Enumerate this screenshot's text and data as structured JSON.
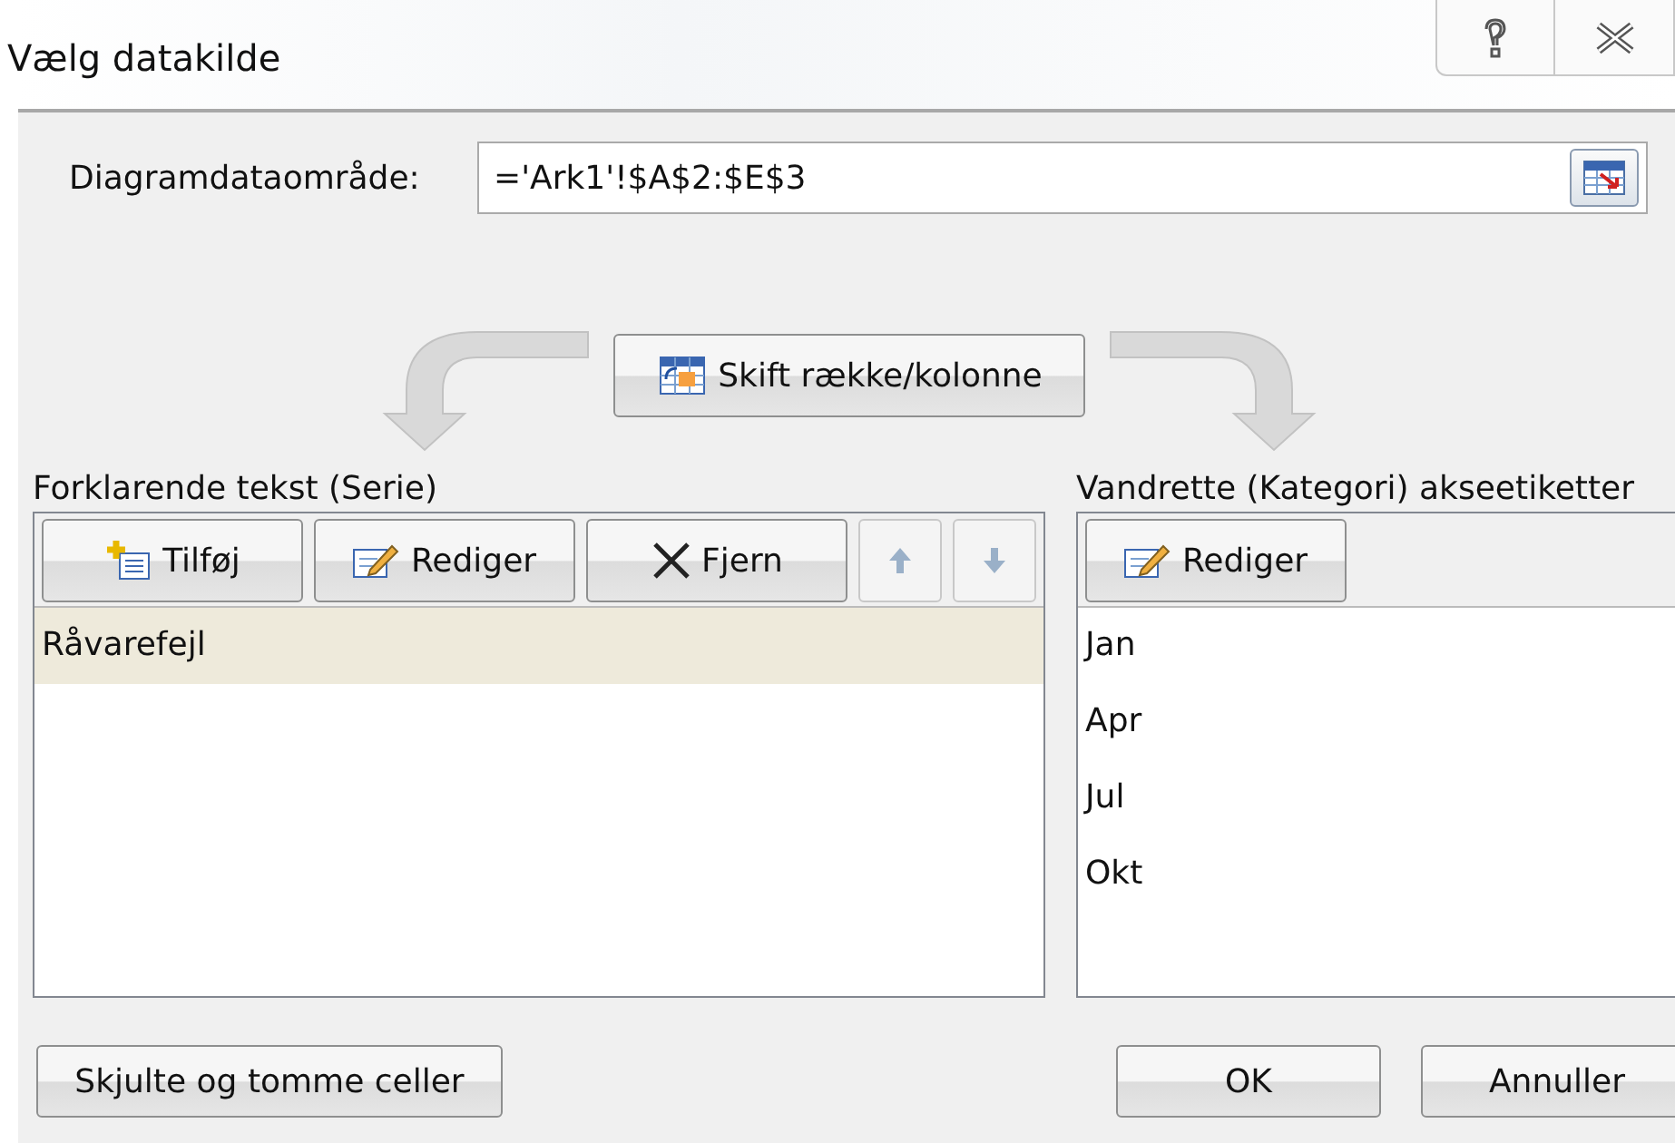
{
  "window": {
    "title": "Vælg datakilde"
  },
  "range": {
    "label": "Diagramdataområde:",
    "value": "='Ark1'!$A$2:$E$3"
  },
  "swap_button": {
    "label": "Skift række/kolonne"
  },
  "series": {
    "label": "Forklarende tekst (Serie)",
    "buttons": [
      {
        "kind": "add",
        "label": "Tilføj",
        "disabled": false
      },
      {
        "kind": "edit",
        "label": "Rediger",
        "disabled": false
      },
      {
        "kind": "remove",
        "label": "Fjern",
        "disabled": false
      },
      {
        "kind": "up",
        "disabled": true
      },
      {
        "kind": "down",
        "disabled": true
      }
    ],
    "items": [
      {
        "label": "Råvarefejl",
        "selected": true
      }
    ]
  },
  "categories": {
    "label": "Vandrette (Kategori) akseetiketter",
    "buttons": [
      {
        "kind": "edit",
        "label": "Rediger",
        "disabled": false
      }
    ],
    "items": [
      {
        "label": "Jan",
        "selected": false
      },
      {
        "label": "Apr",
        "selected": false
      },
      {
        "label": "Jul",
        "selected": false
      },
      {
        "label": "Okt",
        "selected": false
      }
    ]
  },
  "footer": {
    "hidden_cells_button": "Skjulte og tomme celler",
    "ok_button": "OK",
    "cancel_button": "Annuller"
  }
}
